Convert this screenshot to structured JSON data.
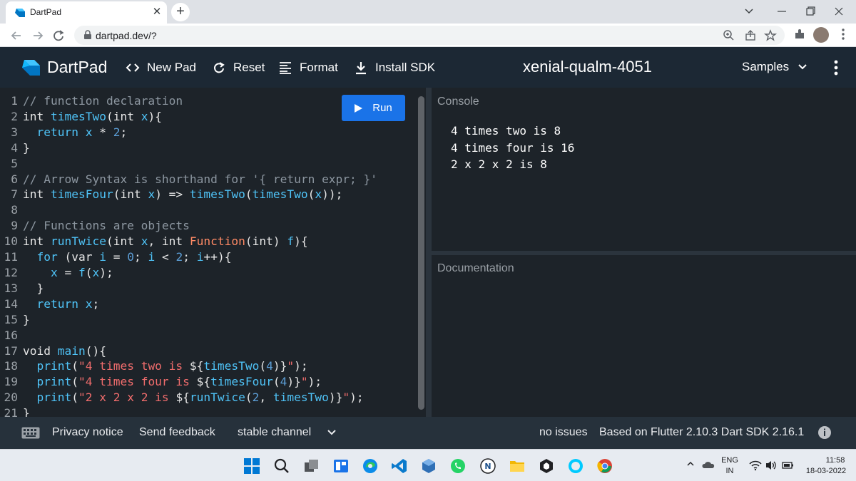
{
  "browser": {
    "tab_title": "DartPad",
    "url": "dartpad.dev/?"
  },
  "header": {
    "app_name": "DartPad",
    "new_pad": "New Pad",
    "reset": "Reset",
    "format": "Format",
    "install_sdk": "Install SDK",
    "pad_name": "xenial-qualm-4051",
    "samples": "Samples"
  },
  "editor": {
    "run_label": "Run"
  },
  "console": {
    "title": "Console",
    "lines": [
      "4 times two is 8",
      "4 times four is 16",
      "2 x 2 x 2 is 8"
    ]
  },
  "documentation": {
    "title": "Documentation"
  },
  "footer": {
    "privacy": "Privacy notice",
    "feedback": "Send feedback",
    "channel": "stable channel",
    "issues": "no issues",
    "version": "Based on Flutter 2.10.3 Dart SDK 2.16.1"
  },
  "taskbar": {
    "lang_top": "ENG",
    "lang_bottom": "IN",
    "time": "11:58",
    "date": "18-03-2022"
  },
  "colors": {
    "run_button": "#1a73e8",
    "header_bg": "#1c2834",
    "editor_bg": "#1d2329"
  },
  "icons": [
    "dart-logo-icon",
    "code-icon",
    "refresh-icon",
    "format-icon",
    "download-icon",
    "chevron-down-icon",
    "more-vert-icon",
    "play-icon",
    "keyboard-icon",
    "info-icon"
  ]
}
